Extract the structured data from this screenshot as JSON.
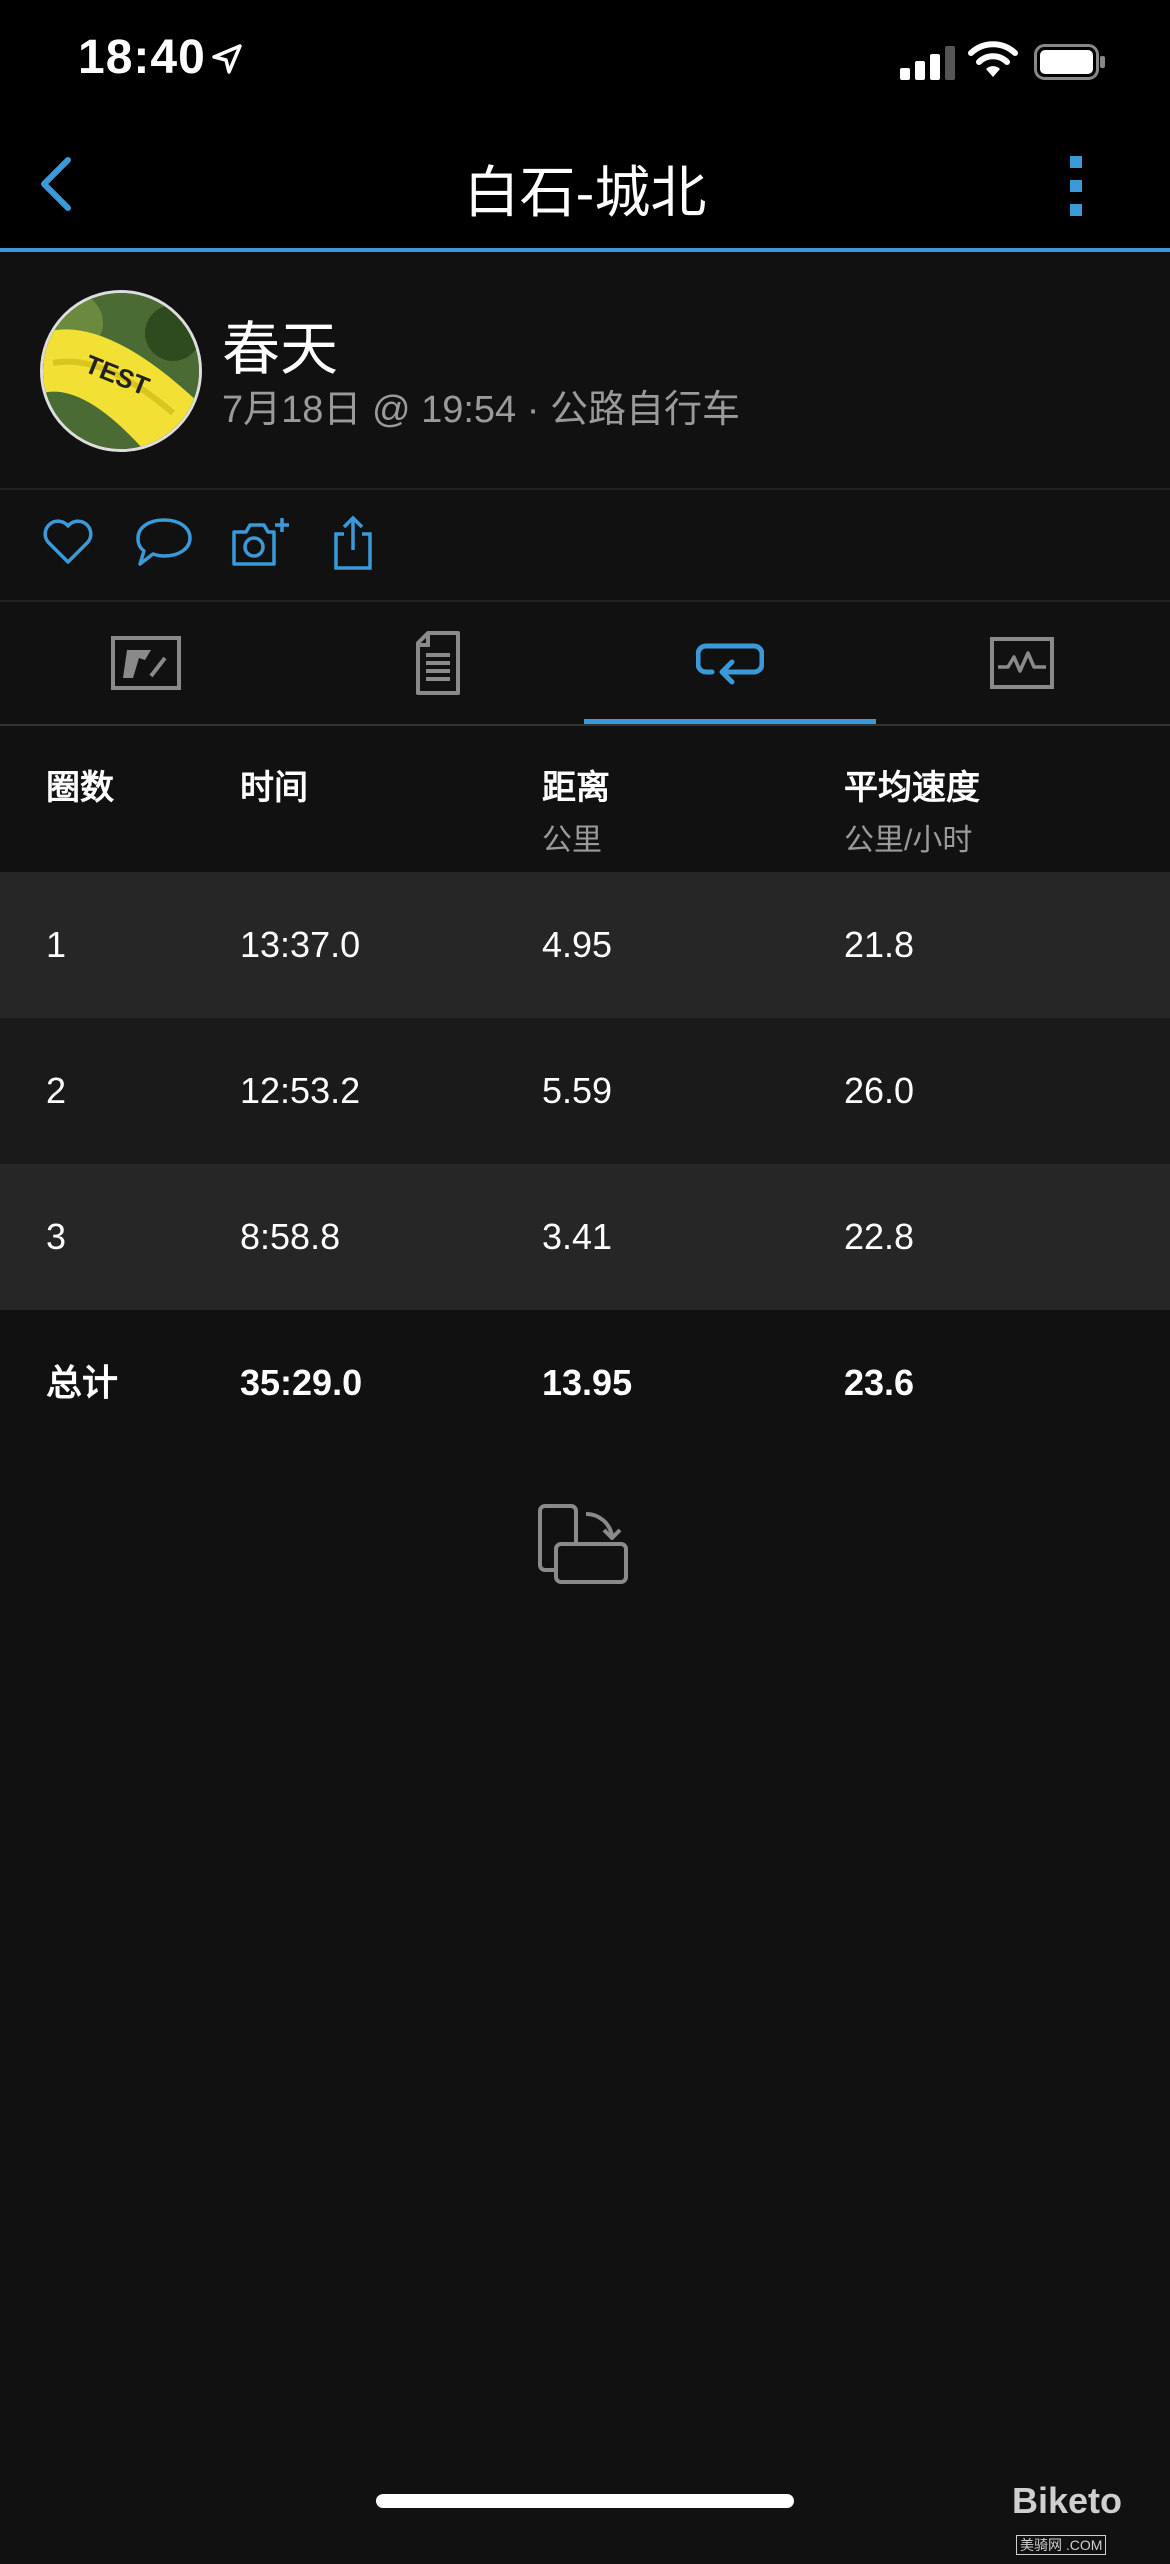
{
  "status_bar": {
    "time": "18:40"
  },
  "nav": {
    "title": "白石-城北"
  },
  "profile": {
    "name": "春天",
    "meta": "7月18日 @ 19:54 · 公路自行车"
  },
  "tabs": [
    "overview-map-tab",
    "details-tab",
    "laps-tab",
    "charts-tab"
  ],
  "active_tab": "laps-tab",
  "table": {
    "headers": [
      {
        "label": "圈数",
        "unit": ""
      },
      {
        "label": "时间",
        "unit": ""
      },
      {
        "label": "距离",
        "unit": "公里"
      },
      {
        "label": "平均速度",
        "unit": "公里/小时"
      }
    ],
    "rows": [
      {
        "lap": "1",
        "time": "13:37.0",
        "distance": "4.95",
        "speed": "21.8"
      },
      {
        "lap": "2",
        "time": "12:53.2",
        "distance": "5.59",
        "speed": "26.0"
      },
      {
        "lap": "3",
        "time": "8:58.8",
        "distance": "3.41",
        "speed": "22.8"
      }
    ],
    "total": {
      "label": "总计",
      "time": "35:29.0",
      "distance": "13.95",
      "speed": "23.6"
    }
  },
  "watermark": {
    "text": "Biketo",
    "badge": "美骑网 .COM"
  },
  "colors": {
    "accent": "#3a9ad9",
    "background": "#111111",
    "row_alt": "#262626"
  }
}
